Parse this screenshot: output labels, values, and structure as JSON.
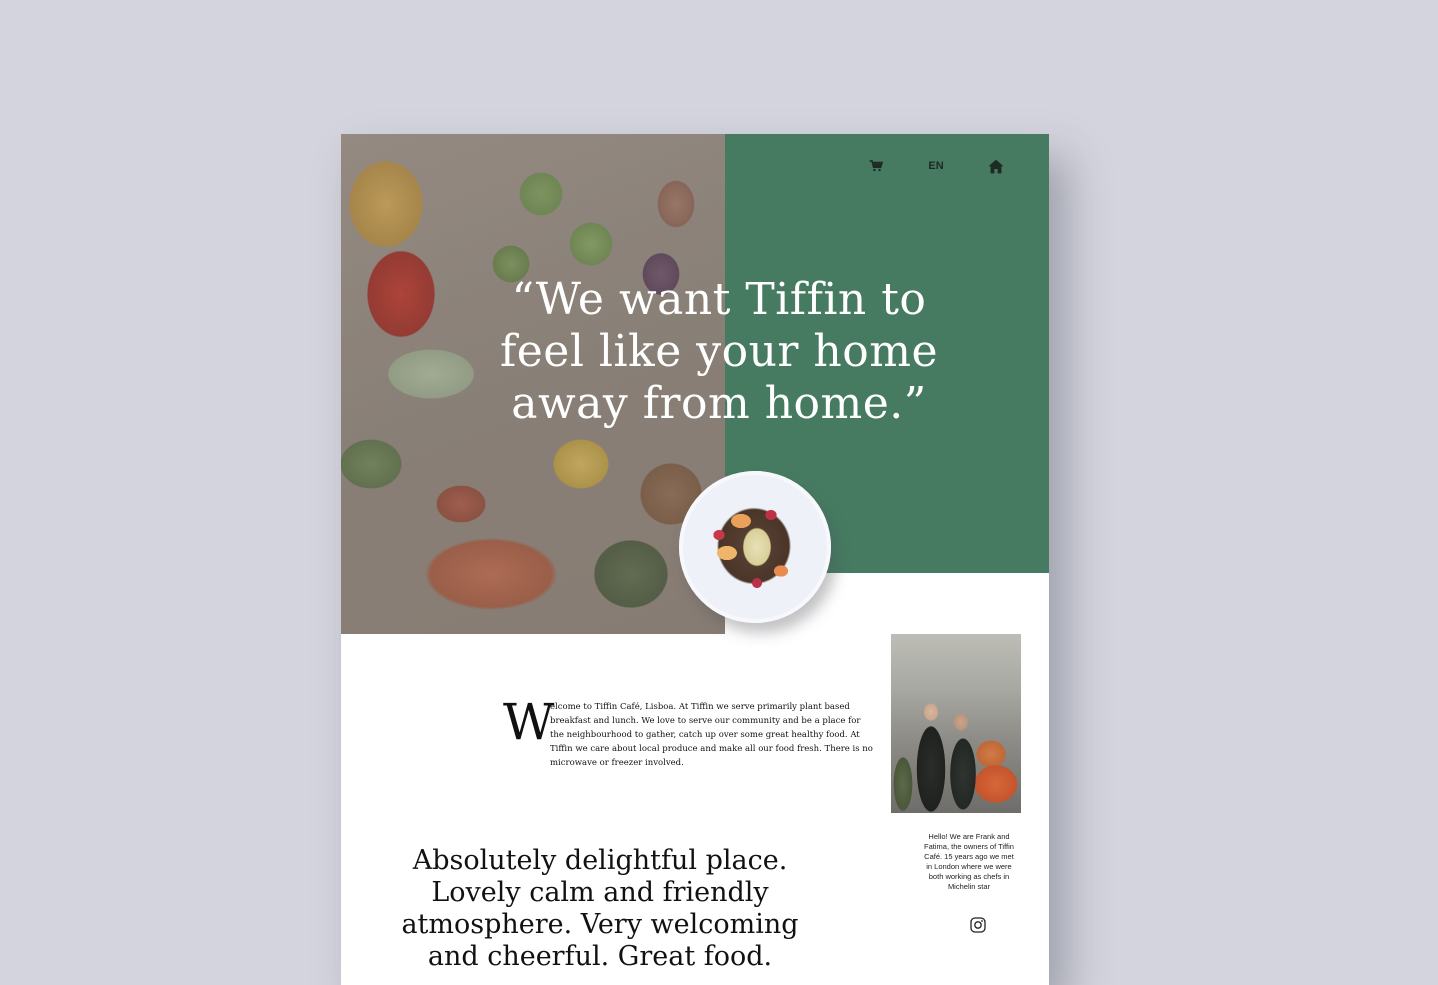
{
  "nav": {
    "cart_icon": "cart-icon",
    "language": "EN",
    "home_icon": "home-icon"
  },
  "hero": {
    "quote": "“We want Tiffin to feel like your home away from home.”",
    "photo": "vegetables-photo",
    "plate": "salad-bowl-photo"
  },
  "intro": {
    "dropcap": "W",
    "text": "elcome to Tiffin Café, Lisboa. At Tiffin we serve primarily plant based breakfast and lunch. We love to serve our community and be a place for the neighbourhood to gather, catch up over some great healthy food. At Tiffin we care about local produce and make all our food fresh. There is no microwave or freezer involved."
  },
  "owners": {
    "photo": "owners-photo",
    "caption": "Hello! We are Frank and Fatima, the owners of Tiffin Café. 15 years ago we met in London where we were both working as chefs in Michelin star",
    "social_icon": "instagram-icon"
  },
  "review": {
    "text": "Absolutely delightful place. Lovely calm and friendly atmosphere. Very welcoming and cheerful. Great food."
  },
  "colors": {
    "background": "#d3d4dd",
    "green": "#467b62",
    "page": "#ffffff"
  }
}
